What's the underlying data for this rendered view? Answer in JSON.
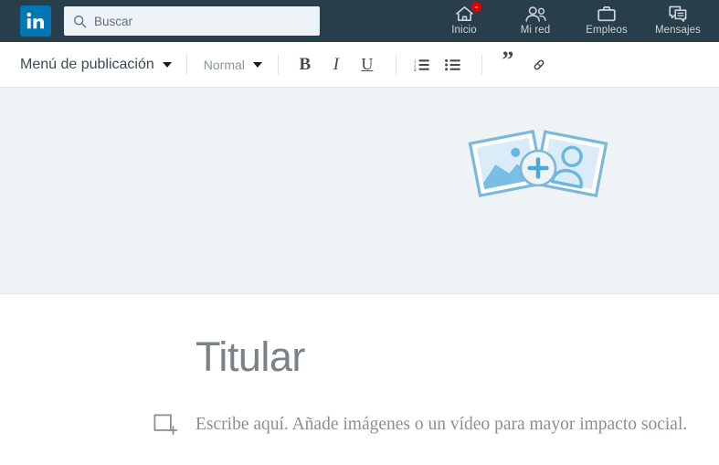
{
  "header": {
    "logo": {
      "icon": "linkedin-logo",
      "color": "#0077b5",
      "text": "in"
    },
    "search": {
      "icon": "search-icon",
      "placeholder": "Buscar",
      "value": ""
    },
    "nav": [
      {
        "icon": "home-icon",
        "label": "Inicio",
        "badge": true
      },
      {
        "icon": "network-icon",
        "label": "Mi red",
        "badge": false
      },
      {
        "icon": "briefcase-icon",
        "label": "Empleos",
        "badge": false
      },
      {
        "icon": "messages-icon",
        "label": "Mensajes",
        "badge": false
      }
    ],
    "background_color": "#283e4a"
  },
  "toolbar": {
    "publish_menu_label": "Menú de publicación",
    "publish_menu_caret": "chevron-down-icon",
    "style_label": "Normal",
    "style_caret": "chevron-down-icon",
    "buttons": [
      {
        "name": "bold-button",
        "glyph": "B"
      },
      {
        "name": "italic-button",
        "glyph": "I"
      },
      {
        "name": "underline-button",
        "glyph": "U"
      },
      {
        "name": "ordered-list-button",
        "glyph": ""
      },
      {
        "name": "bulleted-list-button",
        "glyph": ""
      },
      {
        "name": "blockquote-button",
        "glyph": "”"
      },
      {
        "name": "link-button",
        "glyph": ""
      }
    ]
  },
  "cover": {
    "background_color": "#eef3f6",
    "art": {
      "name": "add-cover-image-illustration",
      "left_card_icon": "landscape-photo-icon",
      "right_card_icon": "person-photo-icon",
      "plus_icon": "plus-circle-icon",
      "accent_color": "#62b0dd",
      "fill_color": "#d7eaf6"
    }
  },
  "article": {
    "headline_placeholder": "Titular",
    "body_icon": "add-media-icon",
    "body_placeholder": "Escribe aquí. Añade imágenes o un vídeo para mayor impacto social."
  }
}
